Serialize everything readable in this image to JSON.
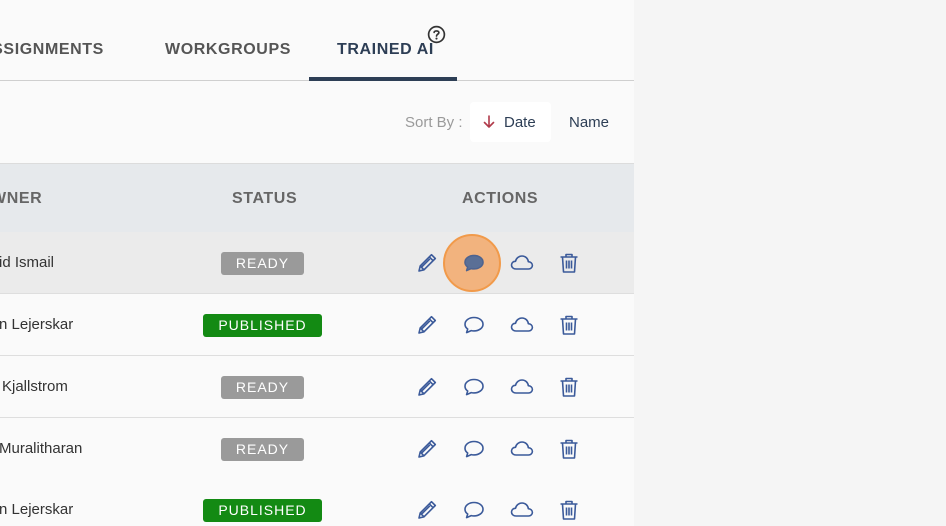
{
  "tabs": {
    "assignments": "ASSIGNMENTS",
    "workgroups": "WORKGROUPS",
    "trained_ai": "TRAINED AI"
  },
  "sort": {
    "label": "Sort By :",
    "date": "Date",
    "name": "Name"
  },
  "table": {
    "headers": {
      "owner": "OWNER",
      "status": "STATUS",
      "actions": "ACTIONS"
    },
    "rows": [
      {
        "owner": "id Ismail",
        "status": "READY"
      },
      {
        "owner": "n Lejerskar",
        "status": "PUBLISHED"
      },
      {
        "owner": "Kjallstrom",
        "status": "READY"
      },
      {
        "owner": "Muralitharan",
        "status": "READY"
      },
      {
        "owner": "n Lejerskar",
        "status": "PUBLISHED"
      }
    ]
  },
  "icons": [
    "help-icon",
    "arrow-down-icon",
    "pencil-icon",
    "comment-icon",
    "cloud-icon",
    "trash-icon"
  ],
  "colors": {
    "accent": "#2d3e55",
    "ready": "#9a9a9a",
    "published": "#138a13",
    "icon": "#3b5a9a",
    "highlight": "#f19a4a"
  }
}
